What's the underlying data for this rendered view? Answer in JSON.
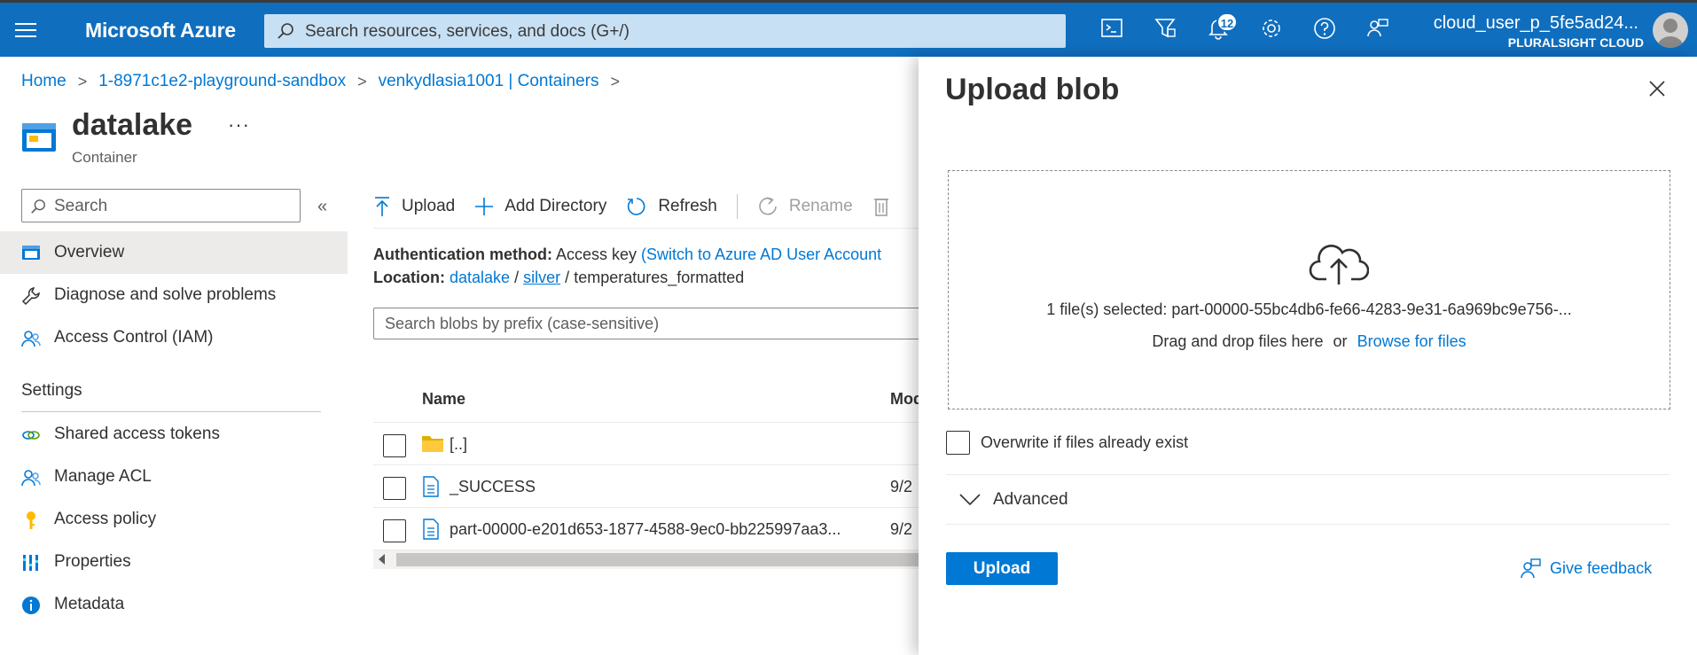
{
  "topbar": {
    "brand": "Microsoft Azure",
    "search_placeholder": "Search resources, services, and docs (G+/)",
    "notifications_count": "12",
    "user_name": "cloud_user_p_5fe5ad24...",
    "user_org": "PLURALSIGHT CLOUD",
    "icons": [
      "cloud-shell-icon",
      "directory-filter-icon",
      "notifications-icon",
      "settings-icon",
      "help-icon",
      "feedback-icon"
    ]
  },
  "breadcrumb": [
    "Home",
    "1-8971c1e2-playground-sandbox",
    "venkydlasia1001 | Containers"
  ],
  "header": {
    "title": "datalake",
    "subtitle": "Container",
    "more": "···"
  },
  "sidebar": {
    "search_placeholder": "Search",
    "collapse": "«",
    "items": [
      {
        "label": "Overview",
        "icon": "overview-icon"
      },
      {
        "label": "Diagnose and solve problems",
        "icon": "wrench-icon"
      },
      {
        "label": "Access Control (IAM)",
        "icon": "people-icon"
      }
    ],
    "settings_heading": "Settings",
    "settings_items": [
      {
        "label": "Shared access tokens",
        "icon": "link-icon"
      },
      {
        "label": "Manage ACL",
        "icon": "people-icon"
      },
      {
        "label": "Access policy",
        "icon": "key-icon"
      },
      {
        "label": "Properties",
        "icon": "properties-icon"
      },
      {
        "label": "Metadata",
        "icon": "info-icon"
      }
    ]
  },
  "toolbar": {
    "upload": "Upload",
    "add_directory": "Add Directory",
    "refresh": "Refresh",
    "rename": "Rename"
  },
  "auth": {
    "label": "Authentication method:",
    "value": "Access key",
    "switch_link": "(Switch to Azure AD User Account"
  },
  "location": {
    "label": "Location:",
    "path": [
      "datalake",
      "silver",
      "temperatures_formatted"
    ],
    "sep": "/"
  },
  "blob_search_placeholder": "Search blobs by prefix (case-sensitive)",
  "table": {
    "columns": [
      "Name",
      "Mod"
    ],
    "rows": [
      {
        "name": "[..]",
        "modified": "",
        "type": "folder"
      },
      {
        "name": "_SUCCESS",
        "modified": "9/2",
        "type": "file"
      },
      {
        "name": "part-00000-e201d653-1877-4588-9ec0-bb225997aa3...",
        "modified": "9/2",
        "type": "file"
      }
    ]
  },
  "upload_panel": {
    "title": "Upload blob",
    "selected": "1 file(s) selected: part-00000-55bc4db6-fe66-4283-9e31-6a969bc9e756-...",
    "drag_text": "Drag and drop files here",
    "or": "or",
    "browse": "Browse for files",
    "overwrite": "Overwrite if files already exist",
    "advanced": "Advanced",
    "upload_button": "Upload",
    "feedback": "Give feedback"
  }
}
